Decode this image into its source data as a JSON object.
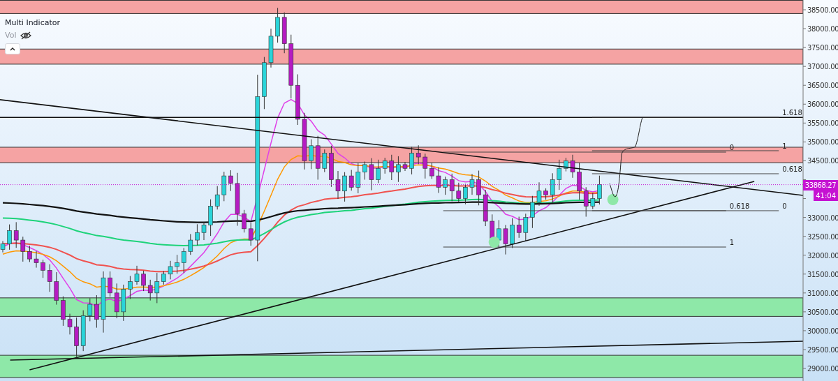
{
  "legend": {
    "indicator": "Multi Indicator",
    "volume": {
      "label": "Vol",
      "hidden": true
    }
  },
  "price_axis": {
    "upper_labels": [
      "38500.00",
      "38000.00",
      "37500.00",
      "37000.00",
      "36500.00",
      "36000.00",
      "35500.00",
      "35000.00",
      "34500.00"
    ],
    "lower_labels": [
      "33000.00",
      "32500.00",
      "32000.00",
      "31500.00",
      "31000.00",
      "30500.00",
      "30000.00",
      "29500.00",
      "29000.00"
    ]
  },
  "zones": [
    {
      "color": "#f5a3a3"
    },
    {
      "color": "#f5a3a3"
    },
    {
      "color": "#f5a3a3"
    },
    {
      "color": "#8ee8a8"
    },
    {
      "color": "#8ee8a8"
    }
  ],
  "fib_labels": [
    "1.618",
    "0",
    "1",
    "0.618",
    "0.618",
    "0",
    "1"
  ],
  "markers": [
    {
      "color": "#8ee8a8"
    },
    {
      "color": "#8ee8a8"
    }
  ],
  "last_price": "33868.27",
  "countdown": "41:04"
}
